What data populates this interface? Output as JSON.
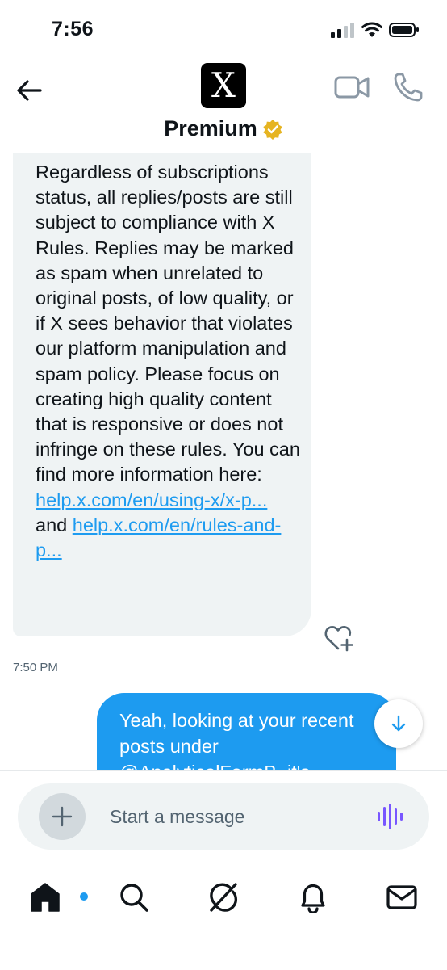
{
  "status_bar": {
    "time": "7:56"
  },
  "header": {
    "avatar_letter": "X",
    "title": "Premium",
    "verified_badge_color": "#e6b422"
  },
  "conversation": {
    "incoming": {
      "text": "Regardless of subscriptions status, all replies/posts are still subject to compliance with X Rules. Replies may be marked as spam when unrelated to original posts, of low quality, or if X sees behavior that violates our platform manipulation and spam policy. Please focus on creating high quality content that is responsive or does not infringe on these rules. You can find more information here:",
      "link1": "help.x.com/en/using-x/x-p...",
      "connector": "and",
      "link2": "help.x.com/en/rules-and-p...",
      "timestamp": "7:50 PM"
    },
    "outgoing": {
      "text": "Yeah, looking at your recent posts under @AnalyticalFarmB, it's"
    }
  },
  "composer": {
    "placeholder": "Start a message"
  },
  "tabs": [
    {
      "icon": "home-icon",
      "active": true,
      "notification_dot": true
    },
    {
      "icon": "search-icon"
    },
    {
      "icon": "grok-icon"
    },
    {
      "icon": "bell-icon"
    },
    {
      "icon": "mail-icon"
    }
  ],
  "colors": {
    "accent": "#1d9bf0",
    "bubble_in": "#eff3f4",
    "text": "#0f1419",
    "muted": "#536471",
    "voice": "#7856ff"
  }
}
